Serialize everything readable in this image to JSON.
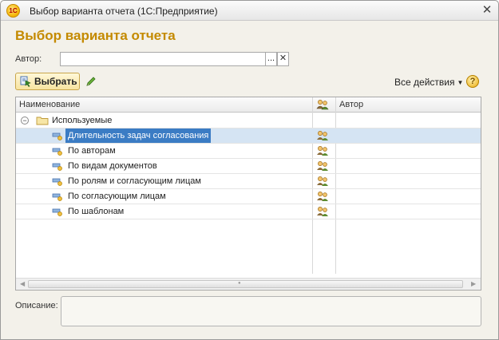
{
  "window": {
    "app_icon_text": "1С",
    "title": "Выбор варианта отчета  (1С:Предприятие)",
    "close_glyph": "✕"
  },
  "form": {
    "title": "Выбор варианта отчета",
    "author_label": "Автор:",
    "author_value": "",
    "select_button_glyph": "...",
    "clear_button_glyph": "✕",
    "description_label": "Описание:",
    "description_value": ""
  },
  "toolbar": {
    "select_label": "Выбрать",
    "all_actions_label": "Все действия",
    "all_actions_caret": "▼",
    "help_glyph": "?"
  },
  "table": {
    "columns": [
      "Наименование",
      "",
      "Автор"
    ],
    "group": {
      "toggle": "−",
      "label": "Используемые"
    },
    "rows": [
      {
        "name": "Длительность задач согласования",
        "author": "",
        "selected": true
      },
      {
        "name": "По авторам",
        "author": ""
      },
      {
        "name": "По видам документов",
        "author": ""
      },
      {
        "name": "По ролям и согласующим лицам",
        "author": ""
      },
      {
        "name": "По согласующим лицам",
        "author": ""
      },
      {
        "name": "По шаблонам",
        "author": ""
      }
    ],
    "scroll_left": "◀",
    "scroll_right": "▶",
    "scroll_grip": "●"
  },
  "colors": {
    "title_accent": "#c48a00",
    "selection": "#3b7cc4",
    "selection_row": "#d5e4f3"
  }
}
